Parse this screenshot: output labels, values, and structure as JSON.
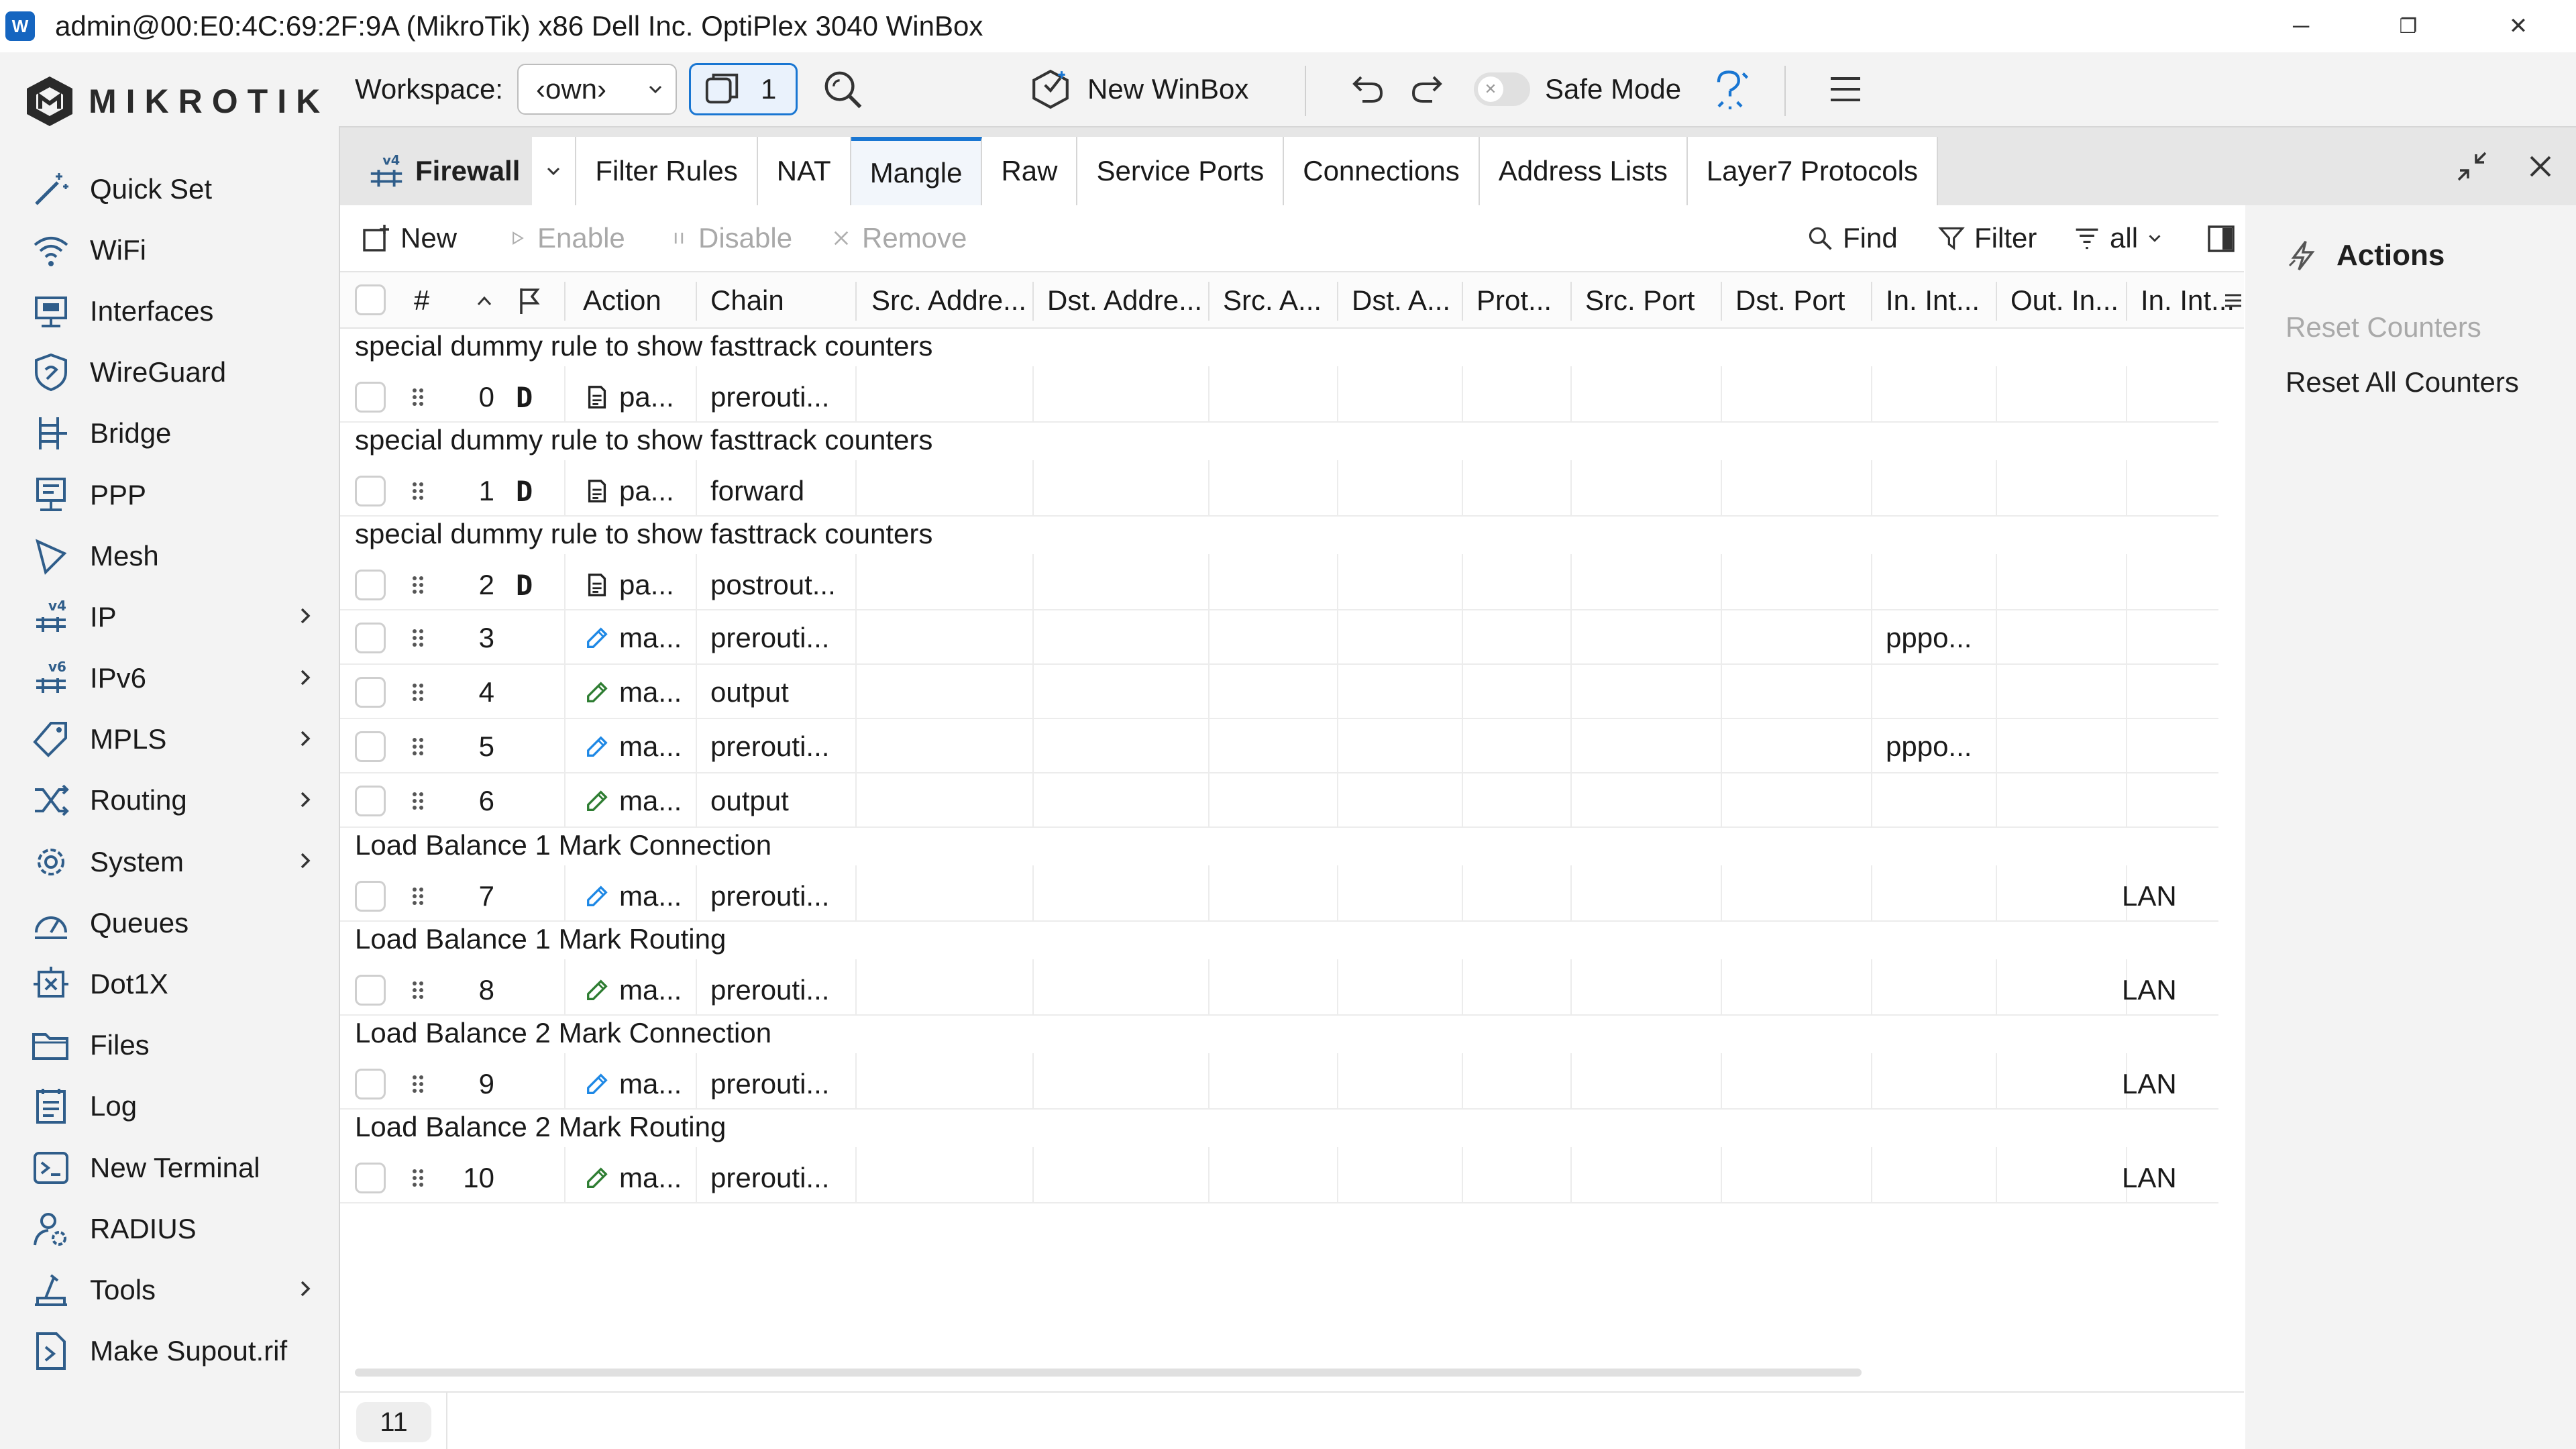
{
  "window": {
    "title": "admin@00:E0:4C:69:2F:9A (MikroTik) x86 Dell Inc. OptiPlex 3040 WinBox",
    "app_icon_text": "W",
    "minimize": "─",
    "maximize": "❐",
    "close": "✕"
  },
  "brand": {
    "name": "MIKROTIK"
  },
  "sidebar": {
    "items": [
      {
        "label": "Quick Set",
        "icon": "wand-icon",
        "chevron": false
      },
      {
        "label": "WiFi",
        "icon": "wifi-icon",
        "chevron": false
      },
      {
        "label": "Interfaces",
        "icon": "interfaces-icon",
        "chevron": false
      },
      {
        "label": "WireGuard",
        "icon": "wireguard-icon",
        "chevron": false
      },
      {
        "label": "Bridge",
        "icon": "bridge-icon",
        "chevron": false
      },
      {
        "label": "PPP",
        "icon": "ppp-icon",
        "chevron": false
      },
      {
        "label": "Mesh",
        "icon": "mesh-icon",
        "chevron": false
      },
      {
        "label": "IP",
        "icon": "ipv4-icon",
        "chevron": true
      },
      {
        "label": "IPv6",
        "icon": "ipv6-icon",
        "chevron": true
      },
      {
        "label": "MPLS",
        "icon": "mpls-icon",
        "chevron": true
      },
      {
        "label": "Routing",
        "icon": "routing-icon",
        "chevron": true
      },
      {
        "label": "System",
        "icon": "gear-icon",
        "chevron": true
      },
      {
        "label": "Queues",
        "icon": "queues-icon",
        "chevron": false
      },
      {
        "label": "Dot1X",
        "icon": "dot1x-icon",
        "chevron": false
      },
      {
        "label": "Files",
        "icon": "folder-icon",
        "chevron": false
      },
      {
        "label": "Log",
        "icon": "log-icon",
        "chevron": false
      },
      {
        "label": "New Terminal",
        "icon": "terminal-icon",
        "chevron": false
      },
      {
        "label": "RADIUS",
        "icon": "radius-icon",
        "chevron": false
      },
      {
        "label": "Tools",
        "icon": "tools-icon",
        "chevron": true
      },
      {
        "label": "Make Supout.rif",
        "icon": "supout-icon",
        "chevron": false
      }
    ],
    "ip_badge": "v4",
    "ipv6_badge": "v6"
  },
  "toolbar": {
    "workspace_label": "Workspace:",
    "workspace_value": "‹own›",
    "window_count": "1",
    "new_winbox": "New WinBox",
    "safe_mode": "Safe Mode"
  },
  "tabs": {
    "group_label": "Firewall",
    "group_badge": "v4",
    "items": [
      "Filter Rules",
      "NAT",
      "Mangle",
      "Raw",
      "Service Ports",
      "Connections",
      "Address Lists",
      "Layer7 Protocols"
    ],
    "active": "Mangle"
  },
  "list_toolbar": {
    "new": "New",
    "enable": "Enable",
    "disable": "Disable",
    "remove": "Remove",
    "find": "Find",
    "filter": "Filter",
    "filter_value": "all"
  },
  "columns": [
    "#",
    "Action",
    "Chain",
    "Src. Addre...",
    "Dst. Addre...",
    "Src. A...",
    "Dst. A...",
    "Prot...",
    "Src. Port",
    "Dst. Port",
    "In. Int...",
    "Out. In...",
    "In. Int..."
  ],
  "rows": [
    {
      "comment": "special dummy rule to show fasttrack counters",
      "num": "0",
      "flag": "D",
      "action": "pa...",
      "action_icon": "document-icon",
      "chain": "prerouti...",
      "in_int": "",
      "in_int_list": ""
    },
    {
      "comment": "special dummy rule to show fasttrack counters",
      "num": "1",
      "flag": "D",
      "action": "pa...",
      "action_icon": "document-icon",
      "chain": "forward",
      "in_int": "",
      "in_int_list": ""
    },
    {
      "comment": "special dummy rule to show fasttrack counters",
      "num": "2",
      "flag": "D",
      "action": "pa...",
      "action_icon": "document-icon",
      "chain": "postrout...",
      "in_int": "",
      "in_int_list": ""
    },
    {
      "comment": "",
      "num": "3",
      "flag": "",
      "action": "ma...",
      "action_icon": "mark-blue-icon",
      "chain": "prerouti...",
      "in_int": "pppo...",
      "in_int_list": ""
    },
    {
      "comment": "",
      "num": "4",
      "flag": "",
      "action": "ma...",
      "action_icon": "mark-green-icon",
      "chain": "output",
      "in_int": "",
      "in_int_list": ""
    },
    {
      "comment": "",
      "num": "5",
      "flag": "",
      "action": "ma...",
      "action_icon": "mark-blue-icon",
      "chain": "prerouti...",
      "in_int": "pppo...",
      "in_int_list": ""
    },
    {
      "comment": "",
      "num": "6",
      "flag": "",
      "action": "ma...",
      "action_icon": "mark-green-icon",
      "chain": "output",
      "in_int": "",
      "in_int_list": ""
    },
    {
      "comment": "Load Balance 1 Mark Connection",
      "num": "7",
      "flag": "",
      "action": "ma...",
      "action_icon": "mark-blue-icon",
      "chain": "prerouti...",
      "in_int": "",
      "in_int_list": "LAN"
    },
    {
      "comment": "Load Balance 1 Mark Routing",
      "num": "8",
      "flag": "",
      "action": "ma...",
      "action_icon": "mark-green-icon",
      "chain": "prerouti...",
      "in_int": "",
      "in_int_list": "LAN"
    },
    {
      "comment": "Load Balance 2 Mark Connection",
      "num": "9",
      "flag": "",
      "action": "ma...",
      "action_icon": "mark-blue-icon",
      "chain": "prerouti...",
      "in_int": "",
      "in_int_list": "LAN"
    },
    {
      "comment": "Load Balance 2 Mark Routing",
      "num": "10",
      "flag": "",
      "action": "ma...",
      "action_icon": "mark-green-icon",
      "chain": "prerouti...",
      "in_int": "",
      "in_int_list": "LAN"
    }
  ],
  "actions": {
    "title": "Actions",
    "reset_counters": "Reset Counters",
    "reset_all_counters": "Reset All Counters"
  },
  "footer": {
    "count": "11"
  },
  "colors": {
    "accent": "#1976d2",
    "mark_blue": "#1e88e5",
    "mark_green": "#2e7d32"
  }
}
